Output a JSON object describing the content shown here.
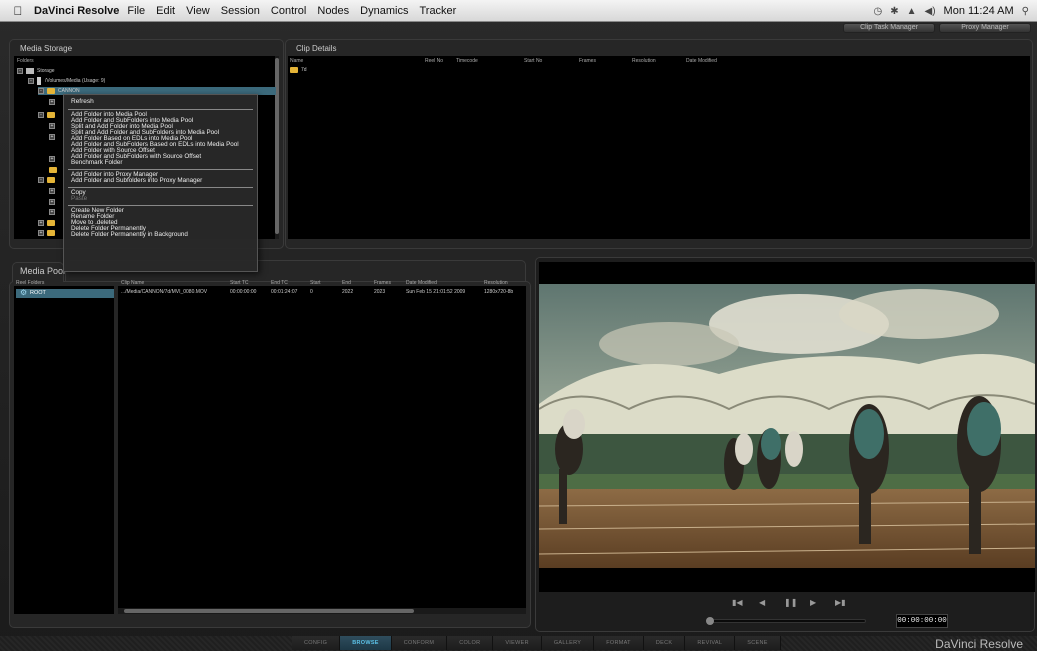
{
  "menubar": {
    "app_name": "DaVinci Resolve",
    "items": [
      "File",
      "Edit",
      "View",
      "Session",
      "Control",
      "Nodes",
      "Dynamics",
      "Tracker"
    ],
    "clock": "Mon 11:24 AM"
  },
  "top_buttons": {
    "clip_task_manager": "Clip Task Manager",
    "proxy_manager": "Proxy Manager"
  },
  "media_storage": {
    "title": "Media Storage",
    "folders_header": "Folders",
    "tree": {
      "storage": "Storage",
      "volume": "/Volumes/Media (Usage: 9)",
      "selected": "CANNON"
    }
  },
  "context_menu": {
    "items": [
      {
        "label": "Refresh",
        "enabled": true,
        "sep_after": true
      },
      {
        "label": "Add Folder into Media Pool",
        "enabled": true
      },
      {
        "label": "Add Folder and SubFolders into Media Pool",
        "enabled": true
      },
      {
        "label": "Split and Add Folder into Media Pool",
        "enabled": true
      },
      {
        "label": "Split and Add Folder and SubFolders into Media Pool",
        "enabled": true
      },
      {
        "label": "Add Folder Based on EDLs into Media Pool",
        "enabled": true
      },
      {
        "label": "Add Folder and SubFolders Based on EDLs into Media Pool",
        "enabled": true
      },
      {
        "label": "Add Folder with Source Offset",
        "enabled": true
      },
      {
        "label": "Add Folder and SubFolders with Source Offset",
        "enabled": true
      },
      {
        "label": "Benchmark Folder",
        "enabled": true,
        "sep_after": true
      },
      {
        "label": "Add Folder into Proxy Manager",
        "enabled": true
      },
      {
        "label": "Add Folder and Subfolders into Proxy Manager",
        "enabled": true,
        "sep_after": true
      },
      {
        "label": "Copy",
        "enabled": true
      },
      {
        "label": "Paste",
        "enabled": false,
        "sep_after": true
      },
      {
        "label": "Create New Folder",
        "enabled": true
      },
      {
        "label": "Rename Folder",
        "enabled": true
      },
      {
        "label": "Move to .deleted",
        "enabled": true
      },
      {
        "label": "Delete Folder Permanently",
        "enabled": true
      },
      {
        "label": "Delete Folder Permanently in Background",
        "enabled": true
      }
    ]
  },
  "clip_details": {
    "title": "Clip Details",
    "columns": [
      "Name",
      "Reel No",
      "Timecode",
      "Start No",
      "Frames",
      "Resolution",
      "Date Modified"
    ],
    "rows": [
      {
        "name": "7d"
      }
    ]
  },
  "media_pool": {
    "title": "Media Pool",
    "reel_folders_header": "Reel Folders",
    "root": "ROOT",
    "columns": [
      "Clip Name",
      "Start TC",
      "End TC",
      "Start",
      "End",
      "Frames",
      "Date Modified",
      "Resolution"
    ],
    "rows": [
      {
        "clip_name": ".../Media/CANNON/7d/MVI_0080.MOV",
        "start_tc": "00:00:00:00",
        "end_tc": "00:01:24:07",
        "start": "0",
        "end": "2022",
        "frames": "2023",
        "date_modified": "Sun Feb 15 21:01:52 2009",
        "resolution": "1280x720-8b"
      }
    ]
  },
  "viewer": {
    "timecode": "00:00:00:00"
  },
  "pages": [
    "CONFIG",
    "BROWSE",
    "CONFORM",
    "COLOR",
    "VIEWER",
    "GALLERY",
    "FORMAT",
    "DECK",
    "REVIVAL",
    "SCENE"
  ],
  "active_page": "BROWSE",
  "brand": "DaVinci Resolve"
}
